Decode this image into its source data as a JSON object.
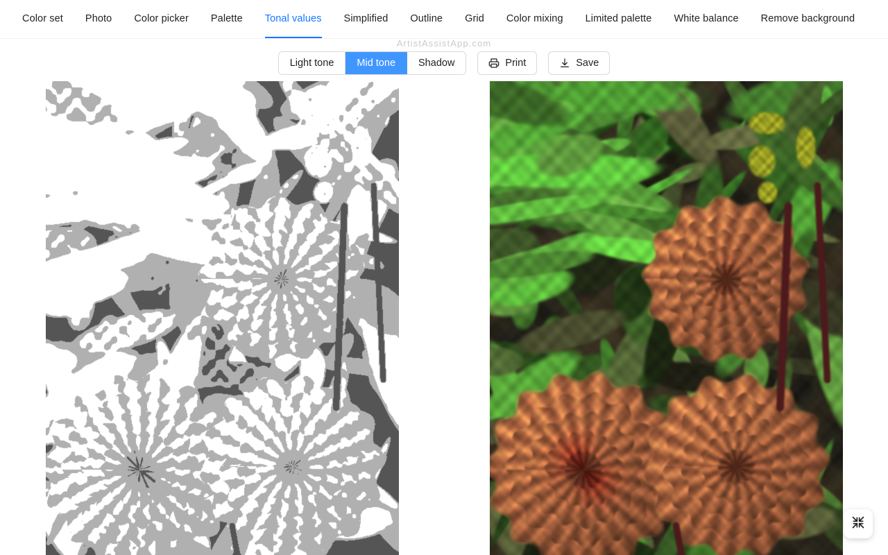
{
  "app": {
    "watermark": "ArtistAssistApp.com",
    "accent_color": "#1677ff",
    "selected_color": "#4096ff"
  },
  "tabs": [
    {
      "label": "Color set",
      "active": false
    },
    {
      "label": "Photo",
      "active": false
    },
    {
      "label": "Color picker",
      "active": false
    },
    {
      "label": "Palette",
      "active": false
    },
    {
      "label": "Tonal values",
      "active": true
    },
    {
      "label": "Simplified",
      "active": false
    },
    {
      "label": "Outline",
      "active": false
    },
    {
      "label": "Grid",
      "active": false
    },
    {
      "label": "Color mixing",
      "active": false
    },
    {
      "label": "Limited palette",
      "active": false
    },
    {
      "label": "White balance",
      "active": false
    },
    {
      "label": "Remove background",
      "active": false
    }
  ],
  "toolbar": {
    "segments": [
      {
        "label": "Light tone",
        "selected": false
      },
      {
        "label": "Mid tone",
        "selected": true
      },
      {
        "label": "Shadow",
        "selected": false
      }
    ],
    "print_label": "Print",
    "print_icon": "printer-icon",
    "save_label": "Save",
    "save_icon": "download-icon"
  },
  "panes": {
    "left": {
      "name": "tonal-values-image",
      "description": "Posterized mid-tone rendering of the dahlia photo",
      "tone_levels": [
        "#555555",
        "#b0b0b0",
        "#ffffff"
      ]
    },
    "right": {
      "name": "original-photo",
      "description": "Original photo of orange dahlia flowers in a garden"
    }
  },
  "fab": {
    "name": "exit-fullscreen-button",
    "icon": "compress-arrows-icon"
  }
}
